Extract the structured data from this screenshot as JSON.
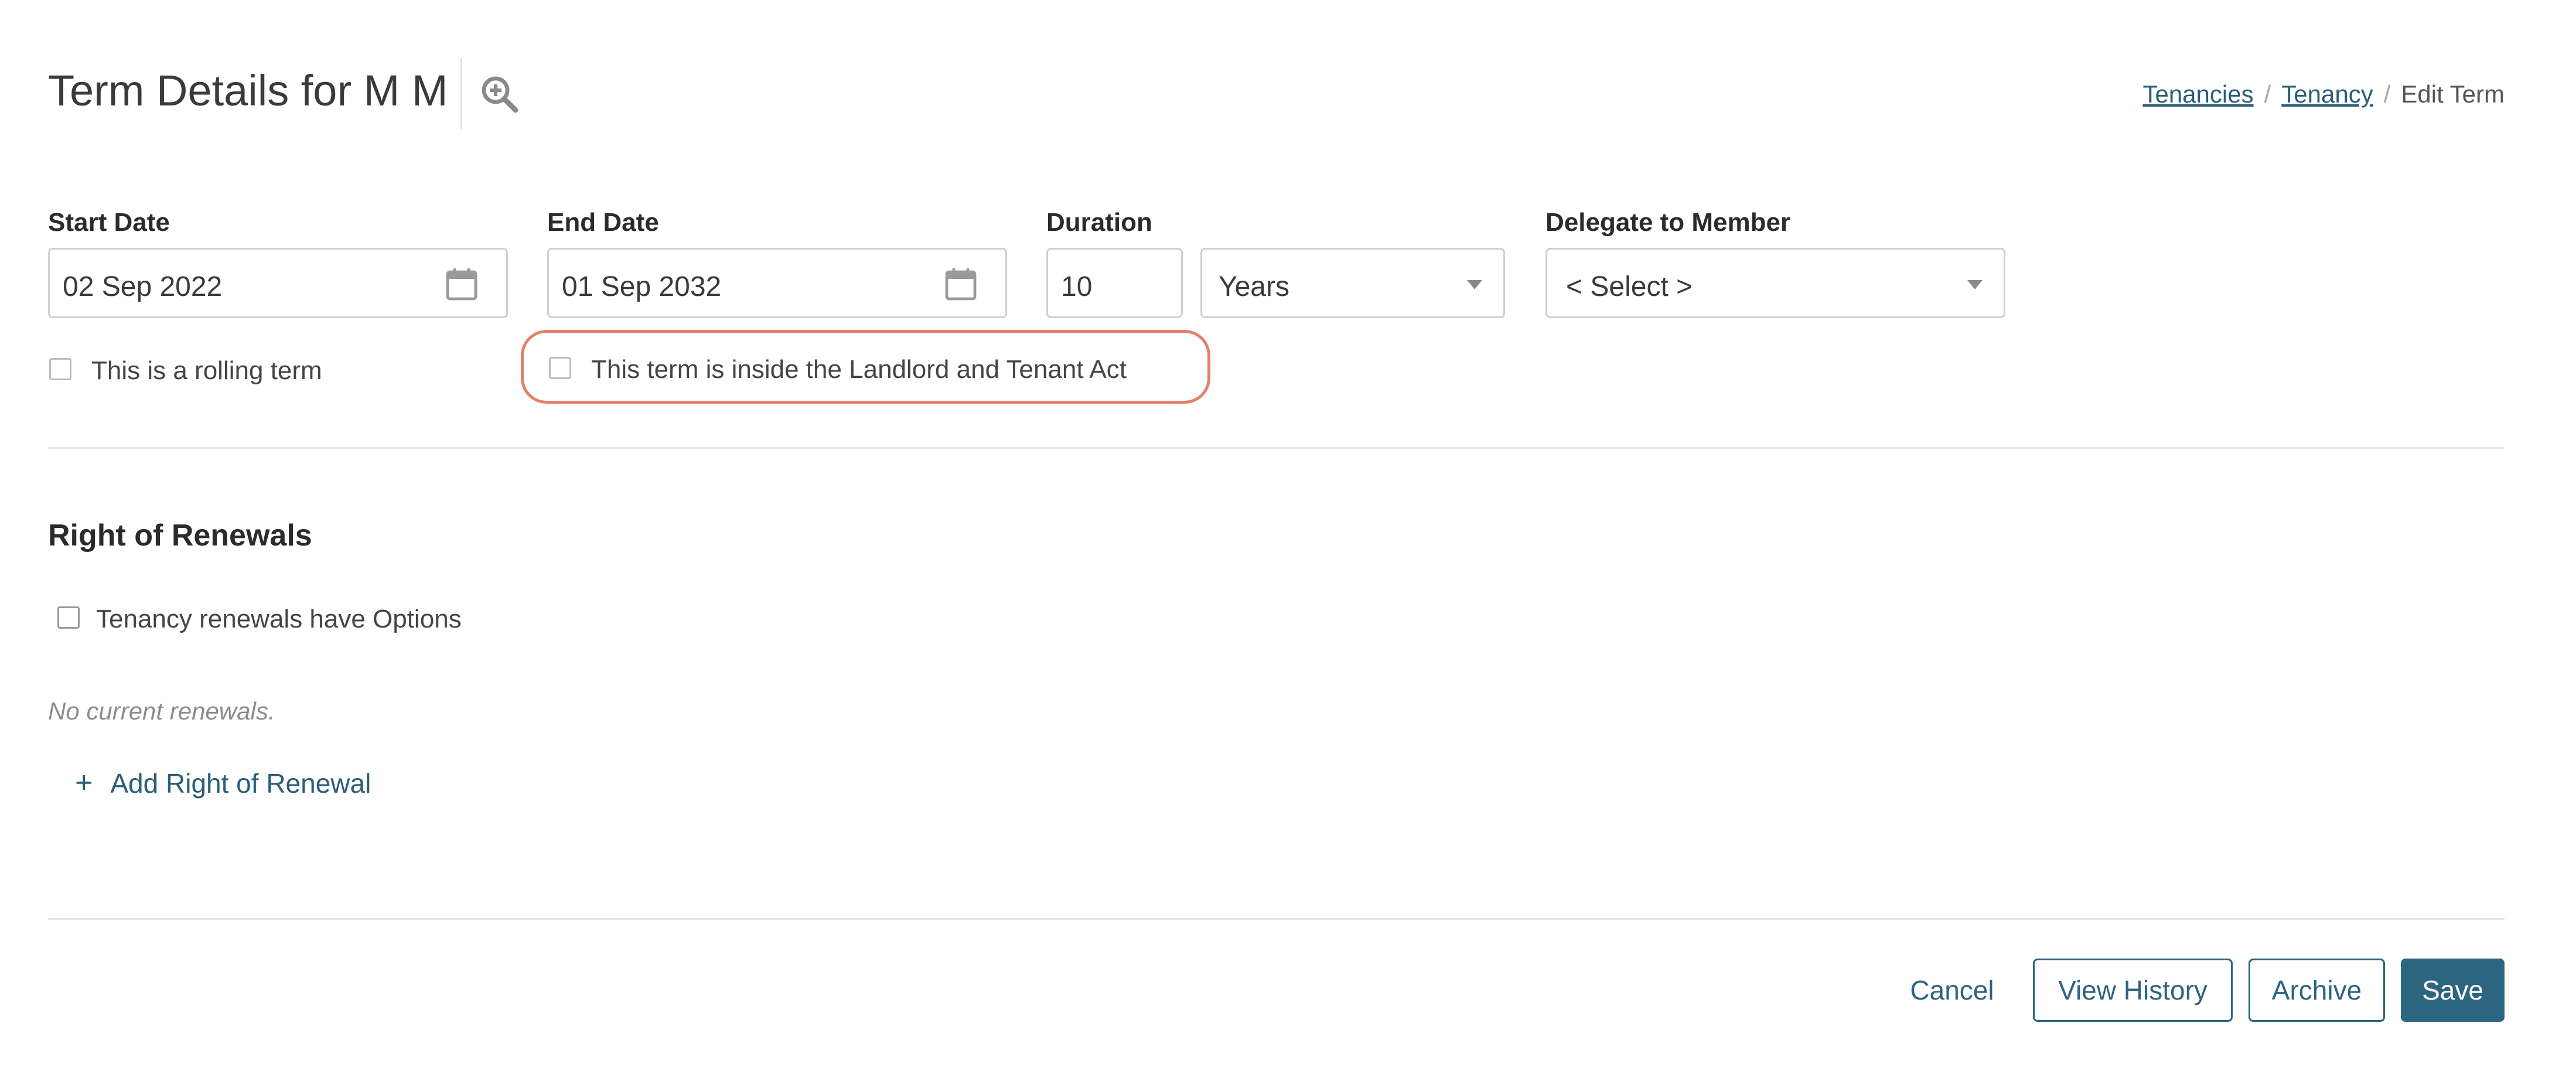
{
  "header": {
    "title": "Term Details for M M",
    "zoom_icon": "zoom-in-icon",
    "breadcrumb": {
      "items": [
        "Tenancies",
        "Tenancy"
      ],
      "separator": "/",
      "current": "Edit Term"
    }
  },
  "term": {
    "start_date": {
      "label": "Start Date",
      "value": "02 Sep 2022",
      "icon": "calendar-icon"
    },
    "end_date": {
      "label": "End Date",
      "value": "01 Sep 2032",
      "icon": "calendar-icon"
    },
    "duration": {
      "label": "Duration",
      "value": "10",
      "unit": "Years"
    },
    "delegate": {
      "label": "Delegate to Member",
      "value": "< Select >"
    },
    "rolling_term": {
      "label": "This is a rolling term",
      "checked": false
    },
    "landlord_tenant_act": {
      "label": "This term is inside the Landlord and Tenant Act",
      "checked": false
    }
  },
  "renewals": {
    "title": "Right of Renewals",
    "options_checkbox": {
      "label": "Tenancy renewals have Options",
      "checked": false
    },
    "empty_text": "No current renewals.",
    "add_label": "Add Right of Renewal",
    "add_icon": "+"
  },
  "actions": {
    "cancel": "Cancel",
    "view_history": "View History",
    "archive": "Archive",
    "save": "Save"
  },
  "colors": {
    "accent": "#2c6580",
    "highlight": "#e3806a",
    "border": "#cfcfcf"
  }
}
